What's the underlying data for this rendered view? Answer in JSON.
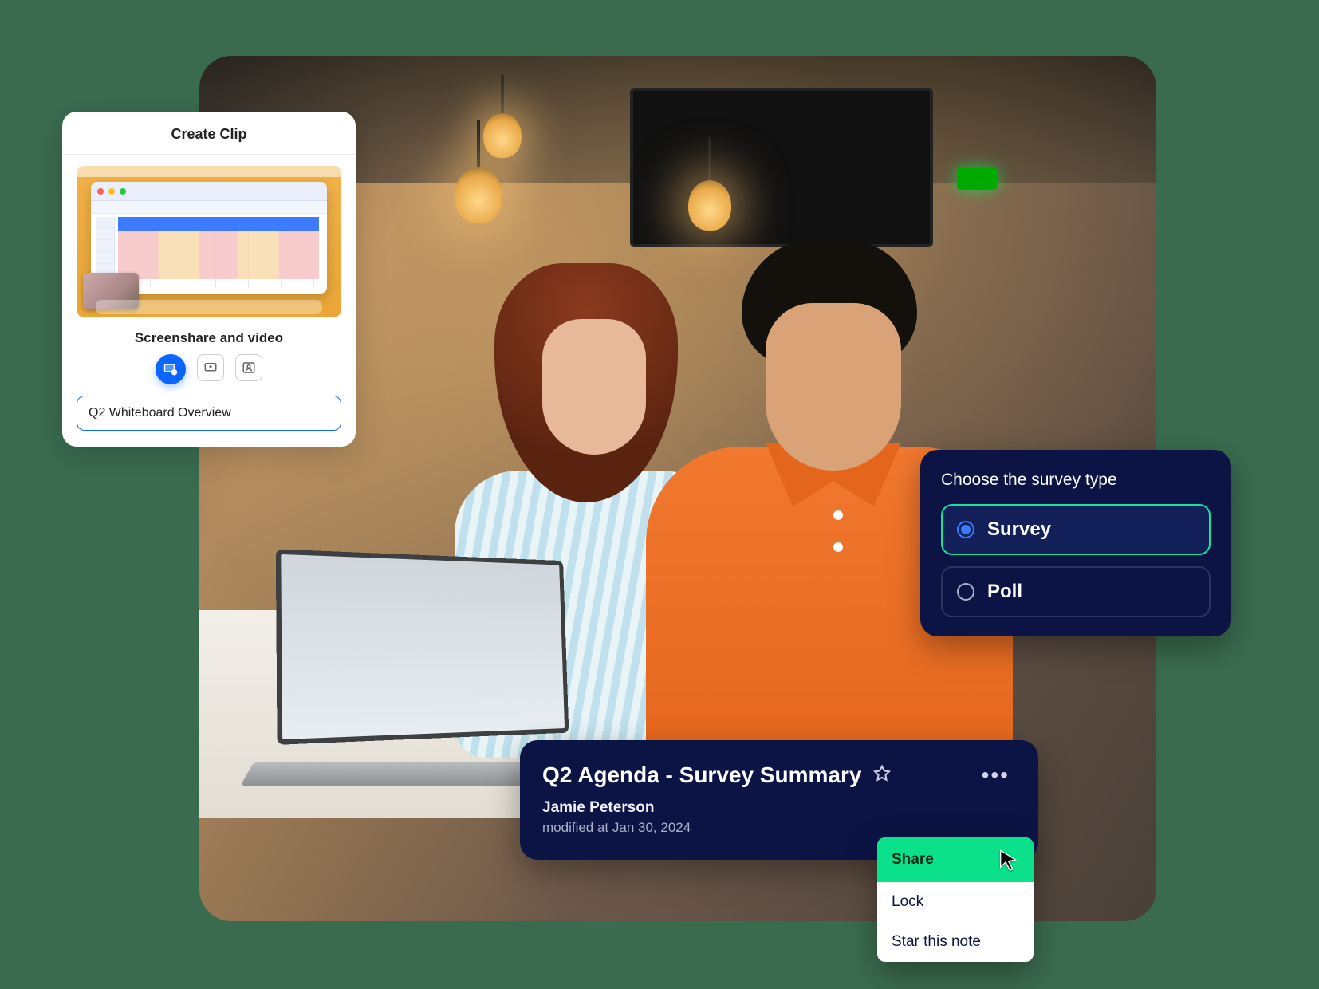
{
  "clip": {
    "title": "Create Clip",
    "subtitle": "Screenshare and video",
    "name_value": "Q2 Whiteboard Overview",
    "modes": {
      "screen_video": "screen-and-video",
      "screen_only": "screen-only",
      "video_only": "video-only"
    }
  },
  "survey": {
    "title": "Choose the survey type",
    "options": {
      "survey": "Survey",
      "poll": "Poll"
    }
  },
  "note": {
    "title": "Q2 Agenda - Survey Summary",
    "author": "Jamie Peterson",
    "modified": "modified at Jan 30, 2024"
  },
  "menu": {
    "share": "Share",
    "lock": "Lock",
    "star": "Star this note"
  }
}
